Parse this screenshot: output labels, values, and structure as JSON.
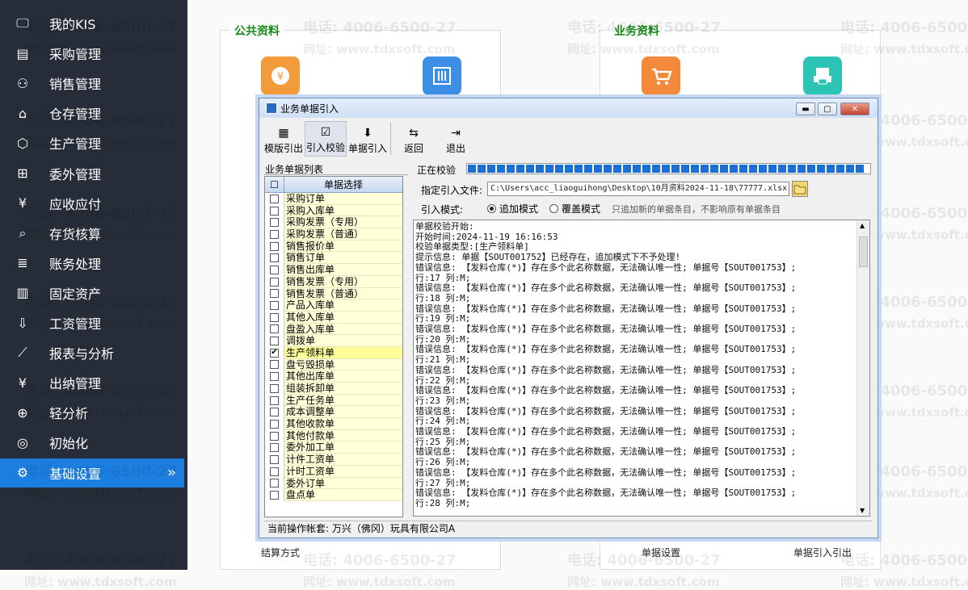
{
  "sidebar": {
    "items": [
      {
        "label": "我的KIS",
        "icon": "monitor-icon"
      },
      {
        "label": "采购管理",
        "icon": "purchase-doc-icon"
      },
      {
        "label": "销售管理",
        "icon": "users-icon"
      },
      {
        "label": "仓存管理",
        "icon": "warehouse-icon"
      },
      {
        "label": "生产管理",
        "icon": "hexagon-gear-icon"
      },
      {
        "label": "委外管理",
        "icon": "outsource-icon"
      },
      {
        "label": "应收应付",
        "icon": "yen-box-icon"
      },
      {
        "label": "存货核算",
        "icon": "inventory-search-icon"
      },
      {
        "label": "账务处理",
        "icon": "ledger-yen-icon"
      },
      {
        "label": "固定资产",
        "icon": "building-icon"
      },
      {
        "label": "工资管理",
        "icon": "payroll-download-icon"
      },
      {
        "label": "报表与分析",
        "icon": "line-chart-icon"
      },
      {
        "label": "出纳管理",
        "icon": "cashier-yen-icon"
      },
      {
        "label": "轻分析",
        "icon": "magnifier-chart-icon"
      },
      {
        "label": "初始化",
        "icon": "target-icon"
      },
      {
        "label": "基础设置",
        "icon": "gear-icon",
        "active": true
      }
    ],
    "active_chevron": "»"
  },
  "main": {
    "public_group_title": "公共资料",
    "business_group_title": "业务资料",
    "bottom_labels": [
      "结算方式",
      "单据设置",
      "单据引入引出"
    ],
    "watermark_phone": "电话: 4006-6500-27",
    "watermark_url": "网址: www.tdxsoft.com"
  },
  "dialog": {
    "title": "业务单据引入",
    "toolbar": [
      {
        "label": "模版引出",
        "icon": "template-export-icon"
      },
      {
        "label": "引入校验",
        "icon": "check-validate-icon",
        "active": true
      },
      {
        "label": "单据引入",
        "icon": "down-arrow-import-icon"
      },
      {
        "label": "返回",
        "icon": "return-icon"
      },
      {
        "label": "退出",
        "icon": "exit-door-icon"
      }
    ],
    "list_title": "业务单据列表",
    "list_header_check": "☐",
    "list_header_name": "单据选择",
    "list_items": [
      {
        "name": "采购订单",
        "checked": false
      },
      {
        "name": "采购入库单",
        "checked": false
      },
      {
        "name": "采购发票（专用）",
        "checked": false
      },
      {
        "name": "采购发票（普通）",
        "checked": false
      },
      {
        "name": "销售报价单",
        "checked": false
      },
      {
        "name": "销售订单",
        "checked": false
      },
      {
        "name": "销售出库单",
        "checked": false
      },
      {
        "name": "销售发票（专用）",
        "checked": false
      },
      {
        "name": "销售发票（普通）",
        "checked": false
      },
      {
        "name": "产品入库单",
        "checked": false
      },
      {
        "name": "其他入库单",
        "checked": false
      },
      {
        "name": "盘盈入库单",
        "checked": false
      },
      {
        "name": "调拨单",
        "checked": false
      },
      {
        "name": "生产领料单",
        "checked": true
      },
      {
        "name": "盘亏毁损单",
        "checked": false
      },
      {
        "name": "其他出库单",
        "checked": false
      },
      {
        "name": "组装拆卸单",
        "checked": false
      },
      {
        "name": "生产任务单",
        "checked": false
      },
      {
        "name": "成本调整单",
        "checked": false
      },
      {
        "name": "其他收款单",
        "checked": false
      },
      {
        "name": "其他付款单",
        "checked": false
      },
      {
        "name": "委外加工单",
        "checked": false
      },
      {
        "name": "计件工资单",
        "checked": false
      },
      {
        "name": "计时工资单",
        "checked": false
      },
      {
        "name": "委外订单",
        "checked": false
      },
      {
        "name": "盘点单",
        "checked": false
      }
    ],
    "progress_label": "正在校验",
    "progress_fraction": 1.0,
    "file_label": "指定引入文件:",
    "file_path": "C:\\Users\\acc_liaoguihong\\Desktop\\10月资料2024-11-18\\77777.xlsx",
    "mode_label": "引入模式:",
    "mode_append": "追加模式",
    "mode_overwrite": "覆盖模式",
    "mode_hint": "只追加新的单据条目，不影响原有单据条目",
    "mode_selected": "append",
    "log_lines": [
      "单据校验开始:",
      "开始时间:2024-11-19 16:16:53",
      "校验单据类型:[生产领料单]",
      "提示信息: 单据【SOUT001752】已经存在，追加模式下不予处理!",
      "错误信息: 【发料仓库(*)】存在多个此名称数据，无法确认唯一性; 单据号【SOUT001753】;",
      "行:17 列:M;",
      "错误信息: 【发料仓库(*)】存在多个此名称数据，无法确认唯一性; 单据号【SOUT001753】;",
      "行:18 列:M;",
      "错误信息: 【发料仓库(*)】存在多个此名称数据，无法确认唯一性; 单据号【SOUT001753】;",
      "行:19 列:M;",
      "错误信息: 【发料仓库(*)】存在多个此名称数据，无法确认唯一性; 单据号【SOUT001753】;",
      "行:20 列:M;",
      "错误信息: 【发料仓库(*)】存在多个此名称数据，无法确认唯一性; 单据号【SOUT001753】;",
      "行:21 列:M;",
      "错误信息: 【发料仓库(*)】存在多个此名称数据，无法确认唯一性; 单据号【SOUT001753】;",
      "行:22 列:M;",
      "错误信息: 【发料仓库(*)】存在多个此名称数据，无法确认唯一性; 单据号【SOUT001753】;",
      "行:23 列:M;",
      "错误信息: 【发料仓库(*)】存在多个此名称数据，无法确认唯一性; 单据号【SOUT001753】;",
      "行:24 列:M;",
      "错误信息: 【发料仓库(*)】存在多个此名称数据，无法确认唯一性; 单据号【SOUT001753】;",
      "行:25 列:M;",
      "错误信息: 【发料仓库(*)】存在多个此名称数据，无法确认唯一性; 单据号【SOUT001753】;",
      "行:26 列:M;",
      "错误信息: 【发料仓库(*)】存在多个此名称数据，无法确认唯一性; 单据号【SOUT001753】;",
      "行:27 列:M;",
      "错误信息: 【发料仓库(*)】存在多个此名称数据，无法确认唯一性; 单据号【SOUT001753】;",
      "行:28 列:M;"
    ],
    "status_text": "当前操作帐套: 万兴（佛冈）玩具有限公司A"
  },
  "colors": {
    "sidebar_bg": "#272d38",
    "sidebar_active": "#1c7fe0",
    "group_title": "#1a8a1a",
    "progress": "#1a6fd8",
    "list_item_bg": "#ffffd8"
  }
}
